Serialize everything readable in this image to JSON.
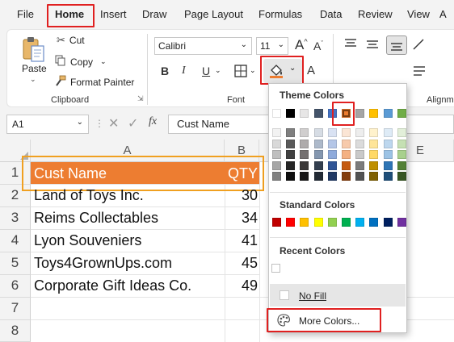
{
  "menu": {
    "file": "File",
    "home": "Home",
    "insert": "Insert",
    "draw": "Draw",
    "page_layout": "Page Layout",
    "formulas": "Formulas",
    "data": "Data",
    "review": "Review",
    "view": "View"
  },
  "ribbon": {
    "paste": "Paste",
    "cut": "Cut",
    "copy": "Copy",
    "format_painter": "Format Painter",
    "clipboard_label": "Clipboard",
    "font_name": "Calibri",
    "font_size": "11",
    "font_label": "Font",
    "bold": "B",
    "italic": "I",
    "underline": "U",
    "grow_font": "A",
    "shrink_font": "A",
    "font_color": "A",
    "alignment_label": "Alignm"
  },
  "formula_bar": {
    "name_box": "A1",
    "fx": "fx",
    "content": "Cust Name"
  },
  "columns": [
    "A",
    "B",
    "E"
  ],
  "rows": [
    "1",
    "2",
    "3",
    "4",
    "5",
    "6",
    "7",
    "8"
  ],
  "table": {
    "header": {
      "name": "Cust Name",
      "qty": "QTY"
    },
    "rows": [
      {
        "name": "Land of Toys Inc.",
        "qty": "30"
      },
      {
        "name": "Reims Collectables",
        "qty": "34"
      },
      {
        "name": "Lyon Souveniers",
        "qty": "41"
      },
      {
        "name": "Toys4GrownUps.com",
        "qty": "45"
      },
      {
        "name": "Corporate Gift Ideas Co.",
        "qty": "49"
      }
    ]
  },
  "fill_menu": {
    "theme_colors": "Theme Colors",
    "standard_colors": "Standard Colors",
    "recent_colors": "Recent Colors",
    "no_fill": "No Fill",
    "more_colors": "More Colors...",
    "theme_top": [
      "#ffffff",
      "#000000",
      "#e7e6e6",
      "#44546a",
      "#4472c4",
      "#ed7d31",
      "#a5a5a5",
      "#ffc000",
      "#5b9bd5",
      "#70ad47"
    ],
    "theme_shades": [
      [
        "#f2f2f2",
        "#d9d9d9",
        "#bfbfbf",
        "#a6a6a6",
        "#808080"
      ],
      [
        "#7f7f7f",
        "#595959",
        "#404040",
        "#262626",
        "#0d0d0d"
      ],
      [
        "#d0cece",
        "#aeabab",
        "#757171",
        "#3a3838",
        "#171616"
      ],
      [
        "#d6dce4",
        "#adb9ca",
        "#8497b0",
        "#333f4f",
        "#222a35"
      ],
      [
        "#d9e2f3",
        "#b4c6e7",
        "#8eaadb",
        "#2f5496",
        "#1f3864"
      ],
      [
        "#fbe5d5",
        "#f7caac",
        "#f4b183",
        "#c55a11",
        "#833c0b"
      ],
      [
        "#ededed",
        "#dbdbdb",
        "#c9c9c9",
        "#7b7b7b",
        "#525252"
      ],
      [
        "#fff2cc",
        "#fee599",
        "#ffd965",
        "#bf9000",
        "#7f6000"
      ],
      [
        "#deebf6",
        "#bdd7ee",
        "#9cc3e5",
        "#2e75b5",
        "#1e4e79"
      ],
      [
        "#e2efd9",
        "#c5e0b3",
        "#a8d08d",
        "#538135",
        "#375623"
      ]
    ],
    "standard": [
      "#c00000",
      "#ff0000",
      "#ffc000",
      "#ffff00",
      "#92d050",
      "#00b050",
      "#00b0f0",
      "#0070c0",
      "#002060",
      "#7030a0"
    ],
    "header_fill": "#ed7d31",
    "highlight": "#e02020",
    "selection": "#f0a020"
  }
}
